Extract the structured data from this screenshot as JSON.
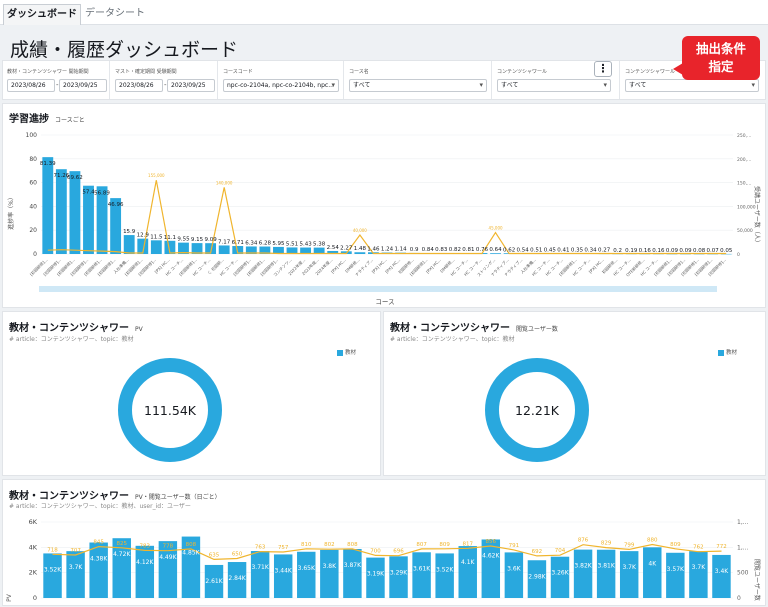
{
  "tabs": [
    {
      "label": "ダッシュボード",
      "active": true
    },
    {
      "label": "データシート",
      "active": false
    }
  ],
  "page_title": "成績・履歴ダッシュボード",
  "callout": {
    "line1": "抽出条件",
    "line2": "指定"
  },
  "filters": {
    "g1": {
      "label": "教材・コンテンツシャワー 開始期間",
      "from": "2023/08/26",
      "to": "2023/09/25"
    },
    "g2": {
      "label": "マスト・確定期間 受験期間",
      "from": "2023/08/26",
      "to": "2023/09/25"
    },
    "g3": {
      "label": "コースコード",
      "value": "npc-co-2104a, npc-co-2104b, npc..."
    },
    "g4": {
      "label": "コース名",
      "value": "すべて"
    },
    "g5": {
      "label": "コンテンツシャワール",
      "value": "すべて"
    },
    "g6": {
      "label": "コンテンツシャワール",
      "value": "すべて"
    }
  },
  "progress": {
    "title": "学習進捗",
    "subtitle": "コースごと",
    "ylabel_left": "進捗率（%）",
    "ylabel_right": "受講ユーザー数（人）",
    "xlabel": "コース",
    "left_ticks": [
      "100",
      "80",
      "60",
      "40",
      "20",
      "0"
    ],
    "right_ticks": [
      "250,...",
      "200,...",
      "150,...",
      "100,000",
      "50,000",
      "0"
    ]
  },
  "pv_donut": {
    "title": "教材・コンテンツシャワー",
    "subtitle": "PV",
    "desc": "# article：コンテンツシャワー、topic：教材",
    "legend": "教材",
    "value": "111.54K",
    "color": "#29a8de"
  },
  "users_donut": {
    "title": "教材・コンテンツシャワー",
    "subtitle": "閲覧ユーザー数",
    "desc": "# article：コンテンツシャワー、topic：教材",
    "legend": "教材",
    "value": "12.21K",
    "color": "#29a8de"
  },
  "daily": {
    "title": "教材・コンテンツシャワー",
    "subtitle": "PV・閲覧ユーザー数（日ごと）",
    "desc": "# article：コンテンツシャワー、topic：教材、user_id：ユーザー",
    "left_ticks": [
      "6K",
      "4K",
      "2K",
      "0"
    ],
    "right_ticks": [
      "1,...",
      "1,...",
      "500",
      "0"
    ],
    "ylabel_left": "PV",
    "ylabel_right": "閲覧ユーザー数"
  },
  "chart_data": [
    {
      "type": "bar",
      "title": "学習進捗",
      "xlabel": "コース",
      "ylabel": "進捗率（%）",
      "ylim": [
        0,
        100
      ],
      "categories": [
        "[初回研修]...",
        "[初回研修]...",
        "[初回研修]...",
        "[初回研修]...",
        "[初回研修]...",
        "[初回研修]...",
        "入社準備...",
        "[初回研修]...",
        "[初回研修]...",
        "[PX] HC...",
        "HC コーチ...",
        "[初回研修]...",
        "HC コーチ...",
        "く 初回研...",
        "HC コーチ...",
        "[初回研修]...",
        "[初回研修]...",
        "[初回研修]...",
        "コンテンツ...",
        "2022年度...",
        "2023年度...",
        "2024年度...",
        "[PX] HC...",
        "DM研修...",
        "ナラティブ...",
        "[PX] HC...",
        "[PX] HC...",
        "初回研修...",
        "[初回研修]...",
        "[PX] HC...",
        "DM研修...",
        "HC コーチ...",
        "HC コーチ...",
        "ストリング...",
        "ナラティブ...",
        "ナラティブ...",
        "入社準備...",
        "HC コーチ...",
        "HC コーチ...",
        "[初回研修]...",
        "HC コーチ...",
        "[PX] HC...",
        "初回研修...",
        "HC コーチ...",
        "OTE新研修...",
        "HC コーチ...",
        "[初回研修]...",
        "[初回研修]...",
        "[初回研修]...",
        "[初回研修]...",
        "[初回研修]..."
      ],
      "series": [
        {
          "name": "進捗率",
          "values": [
            81.39,
            71.26,
            69.62,
            57.4,
            56.89,
            46.96,
            15.9,
            12.9,
            11.5,
            11.1,
            9.55,
            9.15,
            9.09,
            7.17,
            6.71,
            6.34,
            6.28,
            5.95,
            5.51,
            5.43,
            5.38,
            2.54,
            2.27,
            1.48,
            1.46,
            1.24,
            1.14,
            0.9,
            0.84,
            0.83,
            0.82,
            0.81,
            0.76,
            0.64,
            0.62,
            0.54,
            0.51,
            0.45,
            0.41,
            0.35,
            0.34,
            0.27,
            0.2,
            0.19,
            0.16,
            0.16,
            0.09,
            0.09,
            0.08,
            0.07,
            0.05
          ]
        },
        {
          "name": "受講ユーザー数",
          "values": [
            8000,
            9000,
            8000,
            7000,
            6000,
            5000,
            2000,
            2000,
            155000,
            2000,
            3000,
            2000,
            2000,
            140000,
            2000,
            2000,
            2000,
            1000,
            1000,
            1000,
            1000,
            1000,
            1000,
            40000,
            1000,
            1000,
            1000,
            1000,
            1000,
            1000,
            1000,
            1000,
            1000,
            45000,
            1000,
            1000,
            1000,
            1000,
            1000,
            1000,
            1000,
            1000,
            1000,
            1000,
            1000,
            1000,
            1000,
            1000,
            1000,
            1000,
            1000
          ]
        }
      ]
    },
    {
      "type": "pie",
      "title": "教材・コンテンツシャワー PV",
      "categories": [
        "教材"
      ],
      "values": [
        111540
      ]
    },
    {
      "type": "pie",
      "title": "教材・コンテンツシャワー 閲覧ユーザー数",
      "categories": [
        "教材"
      ],
      "values": [
        12210
      ]
    },
    {
      "type": "bar",
      "title": "教材・コンテンツシャワー PV・閲覧ユーザー数（日ごと）",
      "ylim": [
        0,
        6000
      ],
      "series": [
        {
          "name": "PV",
          "labels": [
            "3.52K",
            "3.7K",
            "4.38K",
            "4.72K",
            "4.12K",
            "4.49K",
            "4.85K",
            "2.61K",
            "2.84K",
            "3.71K",
            "3.44K",
            "3.65K",
            "3.8K",
            "3.87K",
            "3.19K",
            "3.29K",
            "3.61K",
            "3.52K",
            "4.1K",
            "4.62K",
            "3.6K",
            "2.98K",
            "3.26K",
            "3.82K",
            "3.81K",
            "3.7K",
            "4K",
            "3.57K",
            "3.7K",
            "3.4K"
          ],
          "values": [
            3520,
            3700,
            4380,
            4720,
            4120,
            4490,
            4850,
            2610,
            2840,
            3710,
            3440,
            3650,
            3800,
            3870,
            3190,
            3290,
            3610,
            3520,
            4100,
            4620,
            3600,
            2980,
            3260,
            3820,
            3810,
            3700,
            4000,
            3570,
            3700,
            3400
          ]
        },
        {
          "name": "閲覧ユーザー数",
          "values": [
            718,
            707,
            845,
            825,
            783,
            778,
            808,
            635,
            650,
            763,
            757,
            810,
            802,
            808,
            700,
            696,
            807,
            809,
            817,
            856,
            791,
            692,
            704,
            876,
            829,
            799,
            880,
            809,
            762,
            772
          ]
        }
      ]
    }
  ]
}
